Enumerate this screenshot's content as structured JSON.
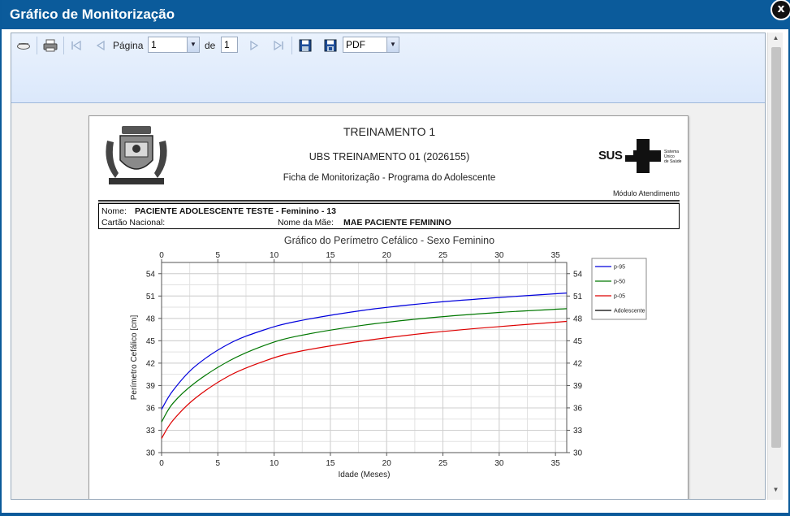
{
  "window": {
    "title": "Gráfico de Monitorização",
    "close_label": "x"
  },
  "toolbar": {
    "page_label": "Página",
    "page_value": "1",
    "of_label": "de",
    "total_pages": "1",
    "format_value": "PDF",
    "icons": [
      "find-icon",
      "print-icon",
      "first-page-icon",
      "previous-page-icon",
      "next-page-icon",
      "last-page-icon",
      "save-icon",
      "export-icon"
    ]
  },
  "report": {
    "title": "TREINAMENTO 1",
    "unit": "UBS TREINAMENTO 01 (2026155)",
    "subtitle": "Ficha de Monitorização - Programa do Adolescente",
    "module": "Módulo Atendimento",
    "logo_text": "SUS",
    "logo_caption": [
      "Sistema",
      "Único",
      "de Saúde"
    ],
    "patient": {
      "name_label": "Nome:",
      "name_value": "PACIENTE ADOLESCENTE TESTE - Feminino - 13",
      "card_label": "Cartão Nacional:",
      "card_value": "",
      "mother_label": "Nome da Mãe:",
      "mother_value": "MAE PACIENTE FEMININO"
    }
  },
  "chart_data": {
    "type": "line",
    "title": "Gráfico do Perímetro Cefálico - Sexo Feminino",
    "xlabel": "Idade (Meses)",
    "ylabel": "Perímetro Cefálico [cm]",
    "xlim": [
      0,
      36
    ],
    "ylim": [
      30,
      55.5
    ],
    "xticks": [
      0,
      5,
      10,
      15,
      20,
      25,
      30,
      35
    ],
    "yticks": [
      30,
      33,
      36,
      39,
      42,
      45,
      48,
      51,
      54
    ],
    "grid": true,
    "legend_position": "right",
    "series": [
      {
        "name": "p-95",
        "color": "#0000dd",
        "x": [
          0,
          1,
          3,
          6,
          9,
          12,
          18,
          24,
          30,
          36
        ],
        "y": [
          35.8,
          38.3,
          41.6,
          44.6,
          46.4,
          47.6,
          49.1,
          50.1,
          50.8,
          51.4
        ]
      },
      {
        "name": "p-50",
        "color": "#007700",
        "x": [
          0,
          1,
          3,
          6,
          9,
          12,
          18,
          24,
          30,
          36
        ],
        "y": [
          34.1,
          36.6,
          39.4,
          42.3,
          44.3,
          45.6,
          47.1,
          48.1,
          48.8,
          49.3
        ]
      },
      {
        "name": "p-05",
        "color": "#dd0000",
        "x": [
          0,
          1,
          3,
          6,
          9,
          12,
          18,
          24,
          30,
          36
        ],
        "y": [
          31.9,
          34.3,
          37.3,
          40.3,
          42.2,
          43.5,
          45.0,
          46.1,
          46.9,
          47.6
        ]
      },
      {
        "name": "Adolescente",
        "color": "#000000",
        "x": [],
        "y": []
      }
    ]
  }
}
